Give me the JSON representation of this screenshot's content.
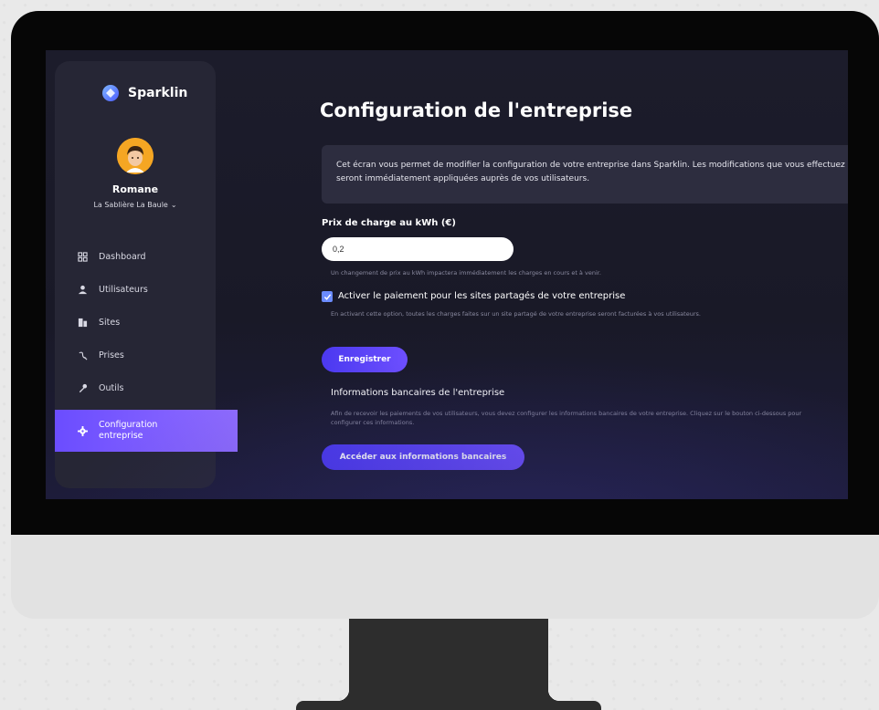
{
  "app": {
    "name": "Sparklin"
  },
  "user": {
    "name": "Romane",
    "organization": "La Sablière La Baule"
  },
  "sidebar": {
    "items": [
      {
        "label": "Dashboard",
        "icon": "dashboard-icon"
      },
      {
        "label": "Utilisateurs",
        "icon": "user-icon"
      },
      {
        "label": "Sites",
        "icon": "building-icon"
      },
      {
        "label": "Prises",
        "icon": "plug-icon"
      },
      {
        "label": "Outils",
        "icon": "wrench-icon"
      },
      {
        "label": "Configuration entreprise",
        "icon": "gear-icon",
        "active": true
      }
    ]
  },
  "main": {
    "title": "Configuration de l'entreprise",
    "info": "Cet écran vous permet de modifier la configuration de votre entreprise dans Sparklin. Les modifications que vous effectuez seront immédiatement appliquées auprès de vos utilisateurs.",
    "price": {
      "label": "Prix de charge au kWh (€)",
      "value": "0,2",
      "hint": "Un changement de prix au kWh impactera immédiatement les charges en cours et à venir."
    },
    "shared_payment": {
      "checked": true,
      "label": "Activer le paiement pour les sites partagés de votre entreprise",
      "hint": "En activant cette option, toutes les charges faites sur un site partagé de votre entreprise seront facturées à vos utilisateurs."
    },
    "save_label": "Enregistrer",
    "bank": {
      "title": "Informations bancaires de l'entreprise",
      "hint": "Afin de recevoir les paiements de vos utilisateurs, vous devez configurer les informations bancaires de votre entreprise. Cliquez sur le bouton ci-dessous pour configurer ces informations.",
      "button_label": "Accéder aux informations bancaires"
    }
  },
  "colors": {
    "accent": "#6b4dff",
    "background": "#1c1c2b",
    "sidebar": "#262635"
  }
}
